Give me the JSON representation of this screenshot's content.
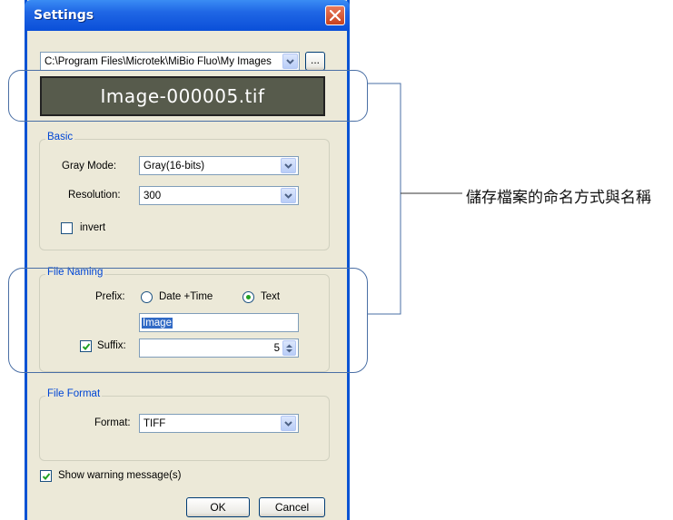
{
  "window": {
    "title": "Settings"
  },
  "path": {
    "value": "C:\\Program Files\\Microtek\\MiBio Fluo\\My Images",
    "browse_label": "..."
  },
  "preview": {
    "filename": "Image-000005.tif"
  },
  "basic": {
    "legend": "Basic",
    "gray_mode_label": "Gray Mode:",
    "gray_mode_value": "Gray(16-bits)",
    "resolution_label": "Resolution:",
    "resolution_value": "300",
    "invert_label": "invert",
    "invert_checked": false
  },
  "file_naming": {
    "legend": "File Naming",
    "prefix_label": "Prefix:",
    "option_date_time": "Date +Time",
    "option_text": "Text",
    "selected": "Text",
    "text_value": "Image",
    "suffix_label": "Suffix:",
    "suffix_checked": true,
    "suffix_value": "5"
  },
  "file_format": {
    "legend": "File Format",
    "format_label": "Format:",
    "format_value": "TIFF"
  },
  "show_warning": {
    "label": "Show warning message(s)",
    "checked": true
  },
  "buttons": {
    "ok": "OK",
    "cancel": "Cancel"
  },
  "annotation": {
    "text": "儲存檔案的命名方式與名稱"
  },
  "colors": {
    "titlebar": "#0a4fd8",
    "dialog_bg": "#ece9d8",
    "legend_text": "#0046d5",
    "close_button": "#c8421f"
  }
}
